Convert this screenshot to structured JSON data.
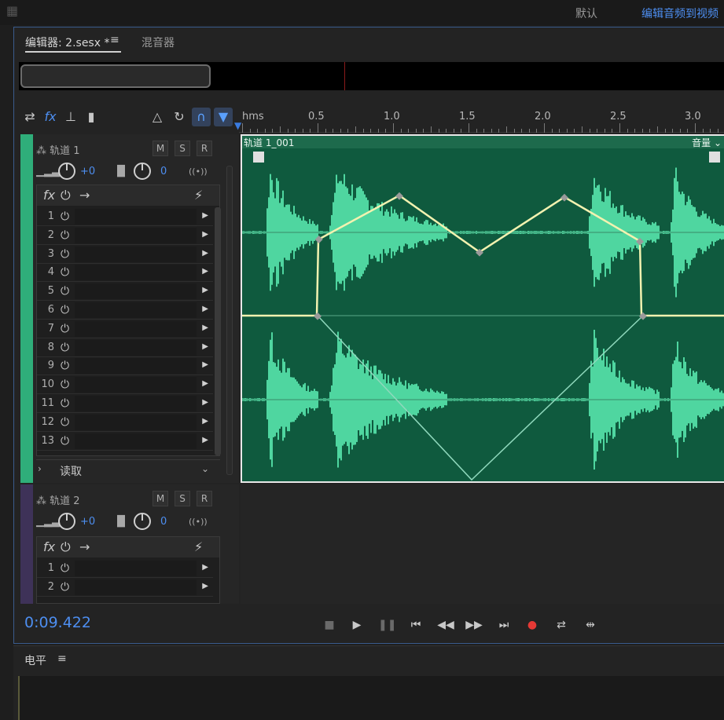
{
  "topbar": {
    "workspace_default": "默认",
    "workspace_video": "编辑音频到视频"
  },
  "editor": {
    "tab_editor": "编辑器: 2.sesx *",
    "tab_menu": "≡",
    "tab_mixer": "混音器"
  },
  "toolbar": {
    "icons": [
      "swap-icon",
      "fx-icon",
      "send-icon",
      "meter-icon",
      "metronome-icon",
      "loop-icon",
      "magnet-icon",
      "marker-icon"
    ],
    "fx_label": "fx"
  },
  "ruler": {
    "unit": "hms",
    "labels": [
      "0.5",
      "1.0",
      "1.5",
      "2.0",
      "2.5",
      "3.0"
    ]
  },
  "tracks": [
    {
      "name": "轨道 1",
      "color": "#2fae7a",
      "mute": "M",
      "solo": "S",
      "record": "R",
      "volume": "+0",
      "pan": "0",
      "fx_slots": [
        "1",
        "2",
        "3",
        "4",
        "5",
        "6",
        "7",
        "8",
        "9",
        "10",
        "11",
        "12",
        "13"
      ],
      "automation_mode": "读取"
    },
    {
      "name": "轨道 2",
      "color": "#4a3a6a",
      "mute": "M",
      "solo": "S",
      "record": "R",
      "volume": "+0",
      "pan": "0",
      "fx_slots": [
        "1",
        "2"
      ]
    }
  ],
  "clip": {
    "title": "轨道 1_001",
    "volume_label": "音量",
    "waveform_color": "#4fd6a0",
    "envelope_color": "#f2f2b0"
  },
  "transport": {
    "timecode": "0:09.422",
    "record_color": "#e53935"
  },
  "levels": {
    "title": "电平",
    "menu": "≡"
  }
}
